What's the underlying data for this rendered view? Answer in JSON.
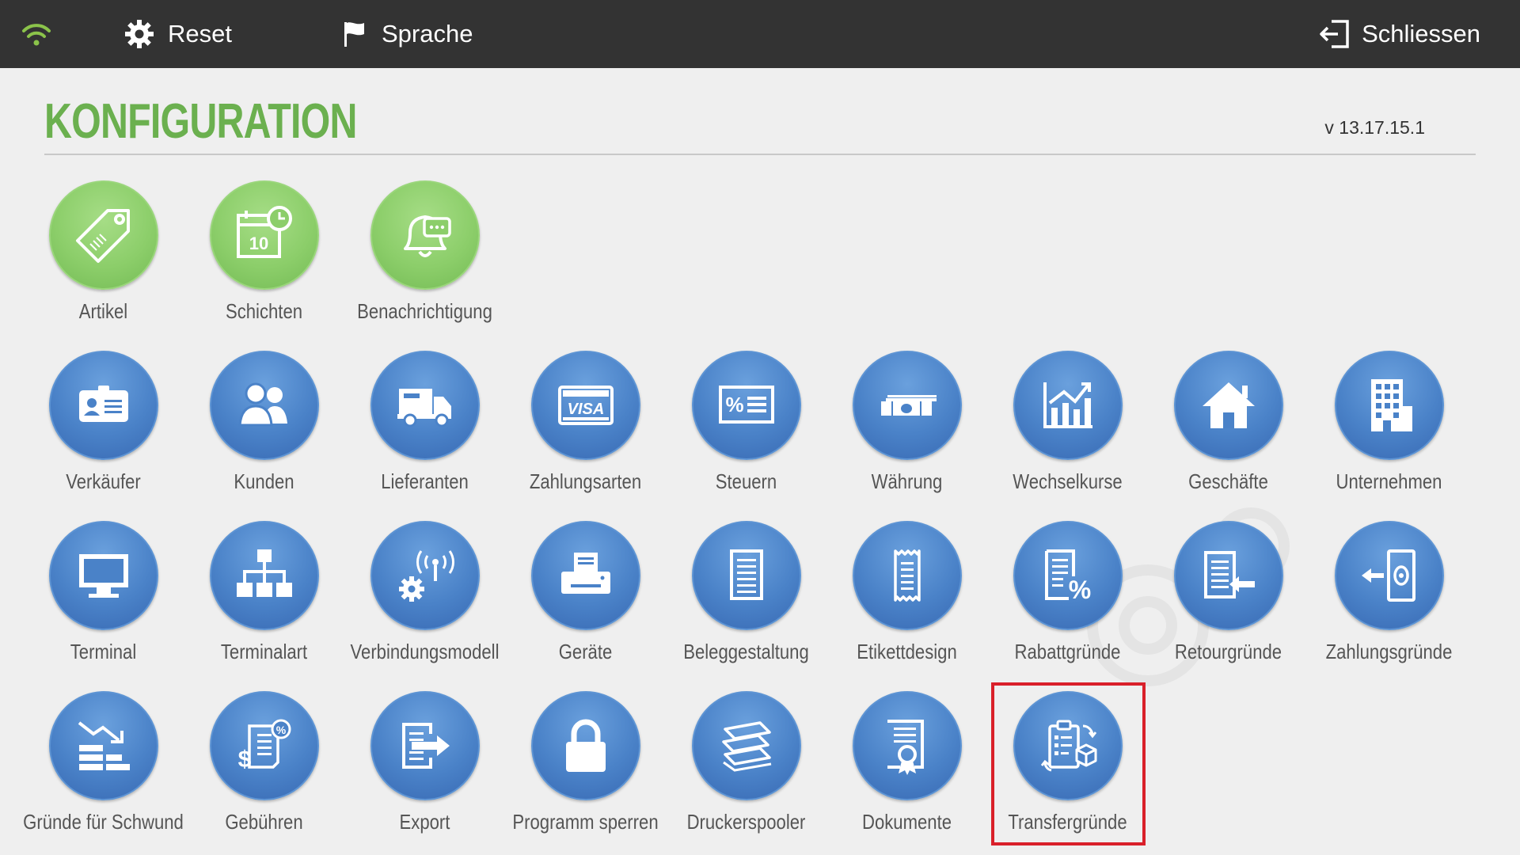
{
  "topbar": {
    "wifi_icon": "wifi-icon",
    "reset_label": "Reset",
    "language_label": "Sprache",
    "close_label": "Schliessen"
  },
  "header": {
    "title": "KONFIGURATION",
    "version": "v 13.17.15.1"
  },
  "colors": {
    "topbar": "#333333",
    "title_green": "#6bb04f",
    "tile_green": "#8cce6a",
    "tile_blue": "#4a82c8",
    "highlight_red": "#d9202a"
  },
  "tiles": {
    "artikel": {
      "label": "Artikel",
      "icon": "price-tag-icon"
    },
    "schichten": {
      "label": "Schichten",
      "icon": "calendar-clock-icon"
    },
    "benachrichtigung": {
      "label": "Benachrichtigung",
      "icon": "bell-chat-icon"
    },
    "verkaeufer": {
      "label": "Verkäufer",
      "icon": "id-card-icon"
    },
    "kunden": {
      "label": "Kunden",
      "icon": "users-icon"
    },
    "lieferanten": {
      "label": "Lieferanten",
      "icon": "truck-icon"
    },
    "zahlungsarten": {
      "label": "Zahlungsarten",
      "icon": "visa-card-icon"
    },
    "steuern": {
      "label": "Steuern",
      "icon": "percent-tax-icon"
    },
    "waehrung": {
      "label": "Währung",
      "icon": "money-stack-icon"
    },
    "wechselkurse": {
      "label": "Wechselkurse",
      "icon": "chart-trend-icon"
    },
    "geschaefte": {
      "label": "Geschäfte",
      "icon": "house-icon"
    },
    "unternehmen": {
      "label": "Unternehmen",
      "icon": "building-icon"
    },
    "terminal": {
      "label": "Terminal",
      "icon": "monitor-icon"
    },
    "terminalart": {
      "label": "Terminalart",
      "icon": "network-tree-icon"
    },
    "verbindungsmodell": {
      "label": "Verbindungsmodell",
      "icon": "antenna-gear-icon"
    },
    "geraete": {
      "label": "Geräte",
      "icon": "printer-icon"
    },
    "beleggestaltung": {
      "label": "Beleggestaltung",
      "icon": "document-lines-icon"
    },
    "etikettdesign": {
      "label": "Etikettdesign",
      "icon": "receipt-icon"
    },
    "rabattgruende": {
      "label": "Rabattgründe",
      "icon": "discount-document-icon"
    },
    "retourgruende": {
      "label": "Retourgründe",
      "icon": "document-return-icon"
    },
    "zahlungsgruende": {
      "label": "Zahlungsgründe",
      "icon": "cash-arrow-icon"
    },
    "schwund": {
      "label": "Gründe für Schwund",
      "icon": "shrinkage-icon"
    },
    "gebuehren": {
      "label": "Gebühren",
      "icon": "fees-dollar-icon"
    },
    "export": {
      "label": "Export",
      "icon": "export-icon"
    },
    "sperren": {
      "label": "Programm sperren",
      "icon": "padlock-icon"
    },
    "druckerspooler": {
      "label": "Druckerspooler",
      "icon": "paper-stack-icon"
    },
    "dokumente": {
      "label": "Dokumente",
      "icon": "certificate-icon"
    },
    "transfergruende": {
      "label": "Transfergründe",
      "icon": "clipboard-transfer-icon"
    }
  }
}
